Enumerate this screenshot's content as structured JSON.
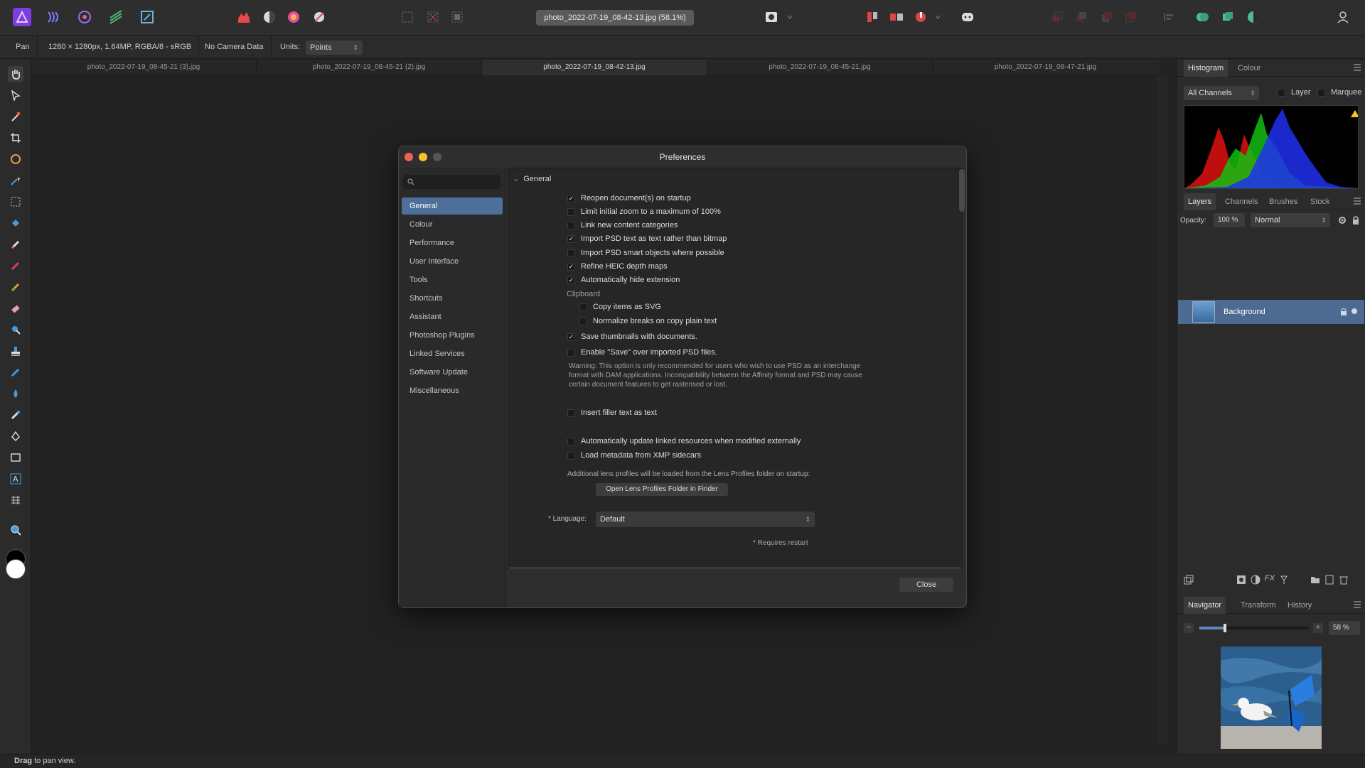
{
  "topbar": {
    "document_title": "photo_2022-07-19_08-42-13.jpg (58.1%)"
  },
  "context": {
    "tool": "Pan",
    "image_info": "1280 × 1280px, 1.64MP, RGBA/8 - sRGB",
    "camera": "No Camera Data",
    "units_label": "Units:",
    "units_value": "Points"
  },
  "tabs": [
    "photo_2022-07-19_08-45-21 (3).jpg",
    "photo_2022-07-19_08-45-21 (2).jpg",
    "photo_2022-07-19_08-42-13.jpg",
    "photo_2022-07-19_08-45-21.jpg",
    "photo_2022-07-19_08-47-21.jpg"
  ],
  "dialog": {
    "title": "Preferences",
    "sidebar": [
      "General",
      "Colour",
      "Performance",
      "User Interface",
      "Tools",
      "Shortcuts",
      "Assistant",
      "Photoshop Plugins",
      "Linked Services",
      "Software Update",
      "Miscellaneous"
    ],
    "section": "General",
    "options": [
      {
        "label": "Reopen document(s) on startup",
        "checked": true
      },
      {
        "label": "Limit initial zoom to a maximum of 100%",
        "checked": false
      },
      {
        "label": "Link new content categories",
        "checked": false
      },
      {
        "label": "Import PSD text as text rather than bitmap",
        "checked": true
      },
      {
        "label": "Import PSD smart objects where possible",
        "checked": false
      },
      {
        "label": "Refine HEIC depth maps",
        "checked": true
      },
      {
        "label": "Automatically hide extension",
        "checked": true
      }
    ],
    "clipboard_label": "Clipboard",
    "clipboard_options": [
      {
        "label": "Copy items as SVG",
        "checked": false
      },
      {
        "label": "Normalize breaks on copy plain text",
        "checked": false
      }
    ],
    "save_thumbnails": {
      "label": "Save thumbnails with documents.",
      "checked": true
    },
    "enable_save": {
      "label": "Enable \"Save\" over imported PSD files.",
      "checked": false
    },
    "warning": "Warning: This option is only recommended for users who wish to use PSD as an interchange format with DAM applications. Incompatibility between the Affinity format and PSD may cause certain document features to get rasterised or lost.",
    "filler": {
      "label": "Insert filler text as text",
      "checked": false
    },
    "auto_update": {
      "label": "Automatically update linked resources when modified externally",
      "checked": false
    },
    "load_metadata": {
      "label": "Load metadata from XMP sidecars",
      "checked": false
    },
    "lens_note": "Additional lens profiles will be loaded from the Lens Profiles folder on startup:",
    "lens_button": "Open Lens Profiles Folder in Finder",
    "language_label": "* Language:",
    "language_value": "Default",
    "restart_note": "* Requires restart",
    "close_button": "Close"
  },
  "right": {
    "top_tabs": [
      "Histogram",
      "Colour"
    ],
    "channels": "All Channels",
    "layer_chk": "Layer",
    "marquee_chk": "Marquee",
    "mid_tabs": [
      "Layers",
      "Channels",
      "Brushes",
      "Stock"
    ],
    "opacity_label": "Opacity:",
    "opacity_value": "100 %",
    "blend_mode": "Normal",
    "layer_name": "Background",
    "bottom_tabs": [
      "Navigator",
      "Transform",
      "History"
    ],
    "zoom_value": "58 %"
  },
  "status": {
    "bold": "Drag",
    "rest": " to pan view."
  },
  "colors": {
    "accent": "#4f6f9b",
    "close_red": "#ed5f57",
    "minimize_yellow": "#f5bf2f"
  }
}
